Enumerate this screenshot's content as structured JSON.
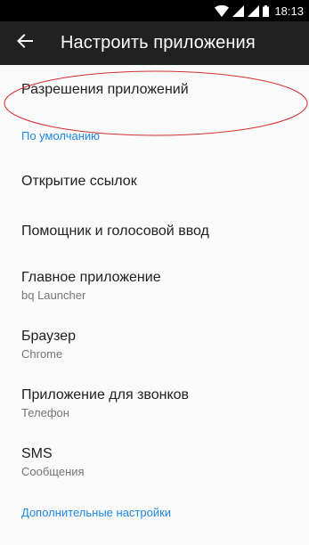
{
  "status_bar": {
    "time": "18:13",
    "icons": [
      "wifi-icon",
      "signal-icon",
      "signal-icon-2",
      "battery-icon"
    ]
  },
  "toolbar": {
    "back_icon": "arrow-back-icon",
    "title": "Настроить приложения"
  },
  "list": {
    "permissions": {
      "title": "Разрешения приложений"
    },
    "section_default": "По умолчанию",
    "open_links": {
      "title": "Открытие ссылок"
    },
    "assistant": {
      "title": "Помощник и голосовой ввод"
    },
    "home_app": {
      "title": "Главное приложение",
      "subtitle": "bq Launcher"
    },
    "browser": {
      "title": "Браузер",
      "subtitle": "Chrome"
    },
    "phone_app": {
      "title": "Приложение для звонков",
      "subtitle": "Телефон"
    },
    "sms": {
      "title": "SMS",
      "subtitle": "Сообщения"
    },
    "section_advanced": "Дополнительные настройки"
  },
  "colors": {
    "accent": "#1e88e5",
    "toolbar": "#212121",
    "status_bar": "#000000",
    "background": "#fafafa",
    "annotation": "#d32f2f"
  }
}
